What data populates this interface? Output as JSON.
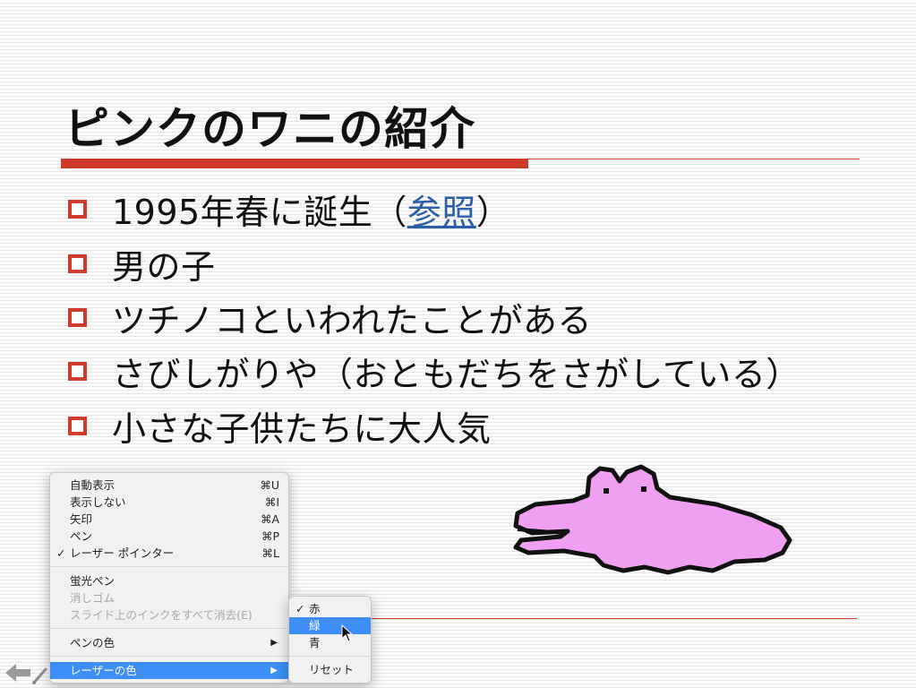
{
  "slide": {
    "title": "ピンクのワニの紹介",
    "bullets": [
      {
        "text": "1995年春に誕生（",
        "link": "参照",
        "after": "）"
      },
      {
        "text": "男の子"
      },
      {
        "text": "ツチノコといわれたことがある"
      },
      {
        "text": "さびしがりや（おともだちをさがしている）"
      },
      {
        "text": "小さな子供たちに大人気"
      }
    ]
  },
  "colors": {
    "accent": "#cc3a2b",
    "link": "#2b5fa8",
    "crocodile": "#f0a0f0",
    "menu_highlight": "#3d8ef7"
  },
  "context_menu": {
    "items": [
      {
        "label": "自動表示",
        "shortcut": "⌘U"
      },
      {
        "label": "表示しない",
        "shortcut": "⌘I"
      },
      {
        "label": "矢印",
        "shortcut": "⌘A"
      },
      {
        "label": "ペン",
        "shortcut": "⌘P"
      },
      {
        "label": "レーザー ポインター",
        "shortcut": "⌘L",
        "checked": true
      },
      {
        "label": "蛍光ペン"
      },
      {
        "label": "消しゴム",
        "disabled": true
      },
      {
        "label": "スライド上のインクをすべて消去(E)",
        "disabled": true
      },
      {
        "label": "ペンの色",
        "submenu": true
      },
      {
        "label": "レーザーの色",
        "submenu": true,
        "selected": true
      }
    ],
    "check_mark": "✓",
    "submenu_arrow": "▶"
  },
  "laser_color_submenu": {
    "items": [
      {
        "label": "赤",
        "checked": true
      },
      {
        "label": "緑",
        "highlighted": true
      },
      {
        "label": "青"
      },
      {
        "label": "リセット"
      }
    ]
  },
  "icons": [
    "previous-arrow-icon",
    "pen-icon",
    "mouse-pointer-icon"
  ]
}
